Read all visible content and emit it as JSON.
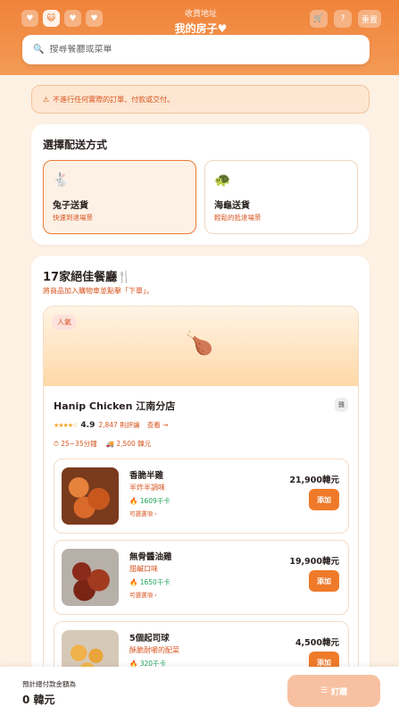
{
  "header": {
    "icons": [
      {
        "icon": "heart-icon",
        "glyph": "♥"
      },
      {
        "icon": "cat-icon",
        "glyph": "😺"
      },
      {
        "icon": "diamond-heart-icon",
        "glyph": "♥"
      },
      {
        "icon": "paw-icon",
        "glyph": "♥"
      }
    ],
    "subtitle": "收貨地址",
    "title": "我的房子♥",
    "cart_glyph": "🛒",
    "help_glyph": "?",
    "reset_label": "重置"
  },
  "search": {
    "placeholder": "搜尋餐廳或菜單",
    "value": ""
  },
  "notice": {
    "text": "不進行任何實際的訂單、付款或交付。"
  },
  "delivery": {
    "title": "選擇配送方式",
    "options": [
      {
        "glyph": "🐇",
        "name": "兔子送貨",
        "desc": "快速到達場景",
        "selected": true
      },
      {
        "glyph": "🐢",
        "name": "海龜送貨",
        "desc": "輕鬆的抵達場景",
        "selected": false
      }
    ]
  },
  "restaurants": {
    "title": "17家絕佳餐廳🍴",
    "subtitle": "將商品加入購物車並點擊「下單」。",
    "card": {
      "badge": "人氣",
      "hero_glyph": "🍗",
      "name": "Hanip Chicken 江南分店",
      "tag": "雞",
      "stars": "★★★★☆",
      "rating": "4.9",
      "reviews": "2,847 則評論",
      "view": "查看 →",
      "time": "⏱ 25~35分鐘",
      "fee": "🚚 2,500 韓元",
      "items": [
        {
          "name": "香脆半雞",
          "desc": "半炸半調味",
          "kcal": "🔥 1609千卡",
          "choose": "可選選項 ›",
          "price": "21,900韓元",
          "add": "添加"
        },
        {
          "name": "無骨醬油雞",
          "desc": "甜鹹口味",
          "kcal": "🔥 1650千卡",
          "choose": "可選選項 ›",
          "price": "19,900韓元",
          "add": "添加"
        },
        {
          "name": "5個起司球",
          "desc": "酥脆耐嚼的配菜",
          "kcal": "🔥 320千卡",
          "choose": "",
          "price": "4,500韓元",
          "add": "添加"
        }
      ]
    }
  },
  "footer": {
    "label": "預計總付款金額為",
    "amount": "0 韓元",
    "order_label": "訂購"
  },
  "colors": {
    "accent": "#ef7a2a",
    "accent_text": "#d8541f",
    "kcal": "#1ea35a"
  }
}
